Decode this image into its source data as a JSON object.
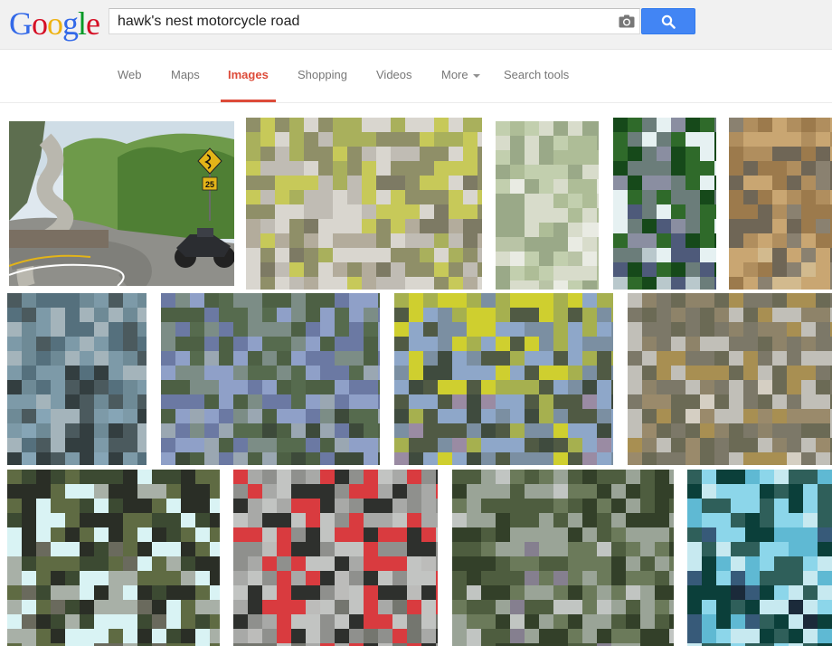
{
  "logo": {
    "text": "Google",
    "letters": [
      {
        "ch": "G",
        "color": "#3369e8"
      },
      {
        "ch": "o",
        "color": "#d50f25"
      },
      {
        "ch": "o",
        "color": "#eeb211"
      },
      {
        "ch": "g",
        "color": "#3369e8"
      },
      {
        "ch": "l",
        "color": "#009925"
      },
      {
        "ch": "e",
        "color": "#d50f25"
      }
    ]
  },
  "search": {
    "value": "hawk's nest motorcycle road"
  },
  "nav": {
    "tabs": [
      {
        "label": "Web",
        "active": false
      },
      {
        "label": "Maps",
        "active": false
      },
      {
        "label": "Images",
        "active": true
      },
      {
        "label": "Shopping",
        "active": false
      },
      {
        "label": "Videos",
        "active": false
      },
      {
        "label": "More",
        "active": false,
        "dropdown": true
      },
      {
        "label": "Search tools",
        "active": false
      }
    ]
  },
  "results": {
    "images": [
      {
        "palette": [
          "#8a9a6e",
          "#6f8f4a",
          "#9fb07a",
          "#c9c7c0",
          "#a8a59a",
          "#5f7a3f",
          "#e3b418"
        ]
      },
      {
        "palette": [
          "#a9b05c",
          "#c7c959",
          "#8f8f68",
          "#c0bcb4",
          "#d9d6cf",
          "#7d7a64",
          "#b3ac9c"
        ]
      },
      {
        "palette": [
          "#c2cfae",
          "#aebd97",
          "#d8dccb",
          "#9aa988",
          "#e9ebe3",
          "#b9c4a6"
        ]
      },
      {
        "palette": [
          "#e6f1f2",
          "#2f6a2a",
          "#16491a",
          "#6b7d7a",
          "#8a8ea1",
          "#4e5a7a",
          "#b9c8cc"
        ]
      },
      {
        "palette": [
          "#b08e5e",
          "#9c7a4c",
          "#c9a672",
          "#6f6656",
          "#8a8170",
          "#d2ba8e"
        ]
      },
      {
        "palette": [
          "#55707d",
          "#6e8a96",
          "#4b5a5e",
          "#7d9aa8",
          "#a4b4bb",
          "#333e40",
          "#86a5b6"
        ]
      },
      {
        "palette": [
          "#566b4e",
          "#7c8d86",
          "#4d6044",
          "#8fa0c8",
          "#6b79a3",
          "#9aa7b2",
          "#3d4a3a"
        ]
      },
      {
        "palette": [
          "#cfcf2f",
          "#a6b04f",
          "#505a44",
          "#8ea7c9",
          "#7b8fa2",
          "#3f4b3e",
          "#9a8ba3"
        ]
      },
      {
        "palette": [
          "#8e8369",
          "#a88f52",
          "#6b6a55",
          "#c1bfb8",
          "#7c7868",
          "#d5cfc3",
          "#9a8a6b"
        ]
      },
      {
        "palette": [
          "#3c4a32",
          "#5f6b43",
          "#2a2e26",
          "#d9f3f4",
          "#a8b0a7",
          "#6a6a5d"
        ]
      },
      {
        "palette": [
          "#a8a9a7",
          "#8f908d",
          "#c2c4c2",
          "#d93b3f",
          "#2e302d",
          "#bcbcba",
          "#74766f"
        ]
      },
      {
        "palette": [
          "#4e5d3f",
          "#6b7a5a",
          "#334029",
          "#9aa497",
          "#c1c5c2",
          "#857f8f"
        ]
      },
      {
        "palette": [
          "#8cd6ea",
          "#5fb9d3",
          "#0b3f3a",
          "#2f5f5a",
          "#c7e9f0",
          "#375a79",
          "#1b2a3a"
        ]
      }
    ]
  }
}
